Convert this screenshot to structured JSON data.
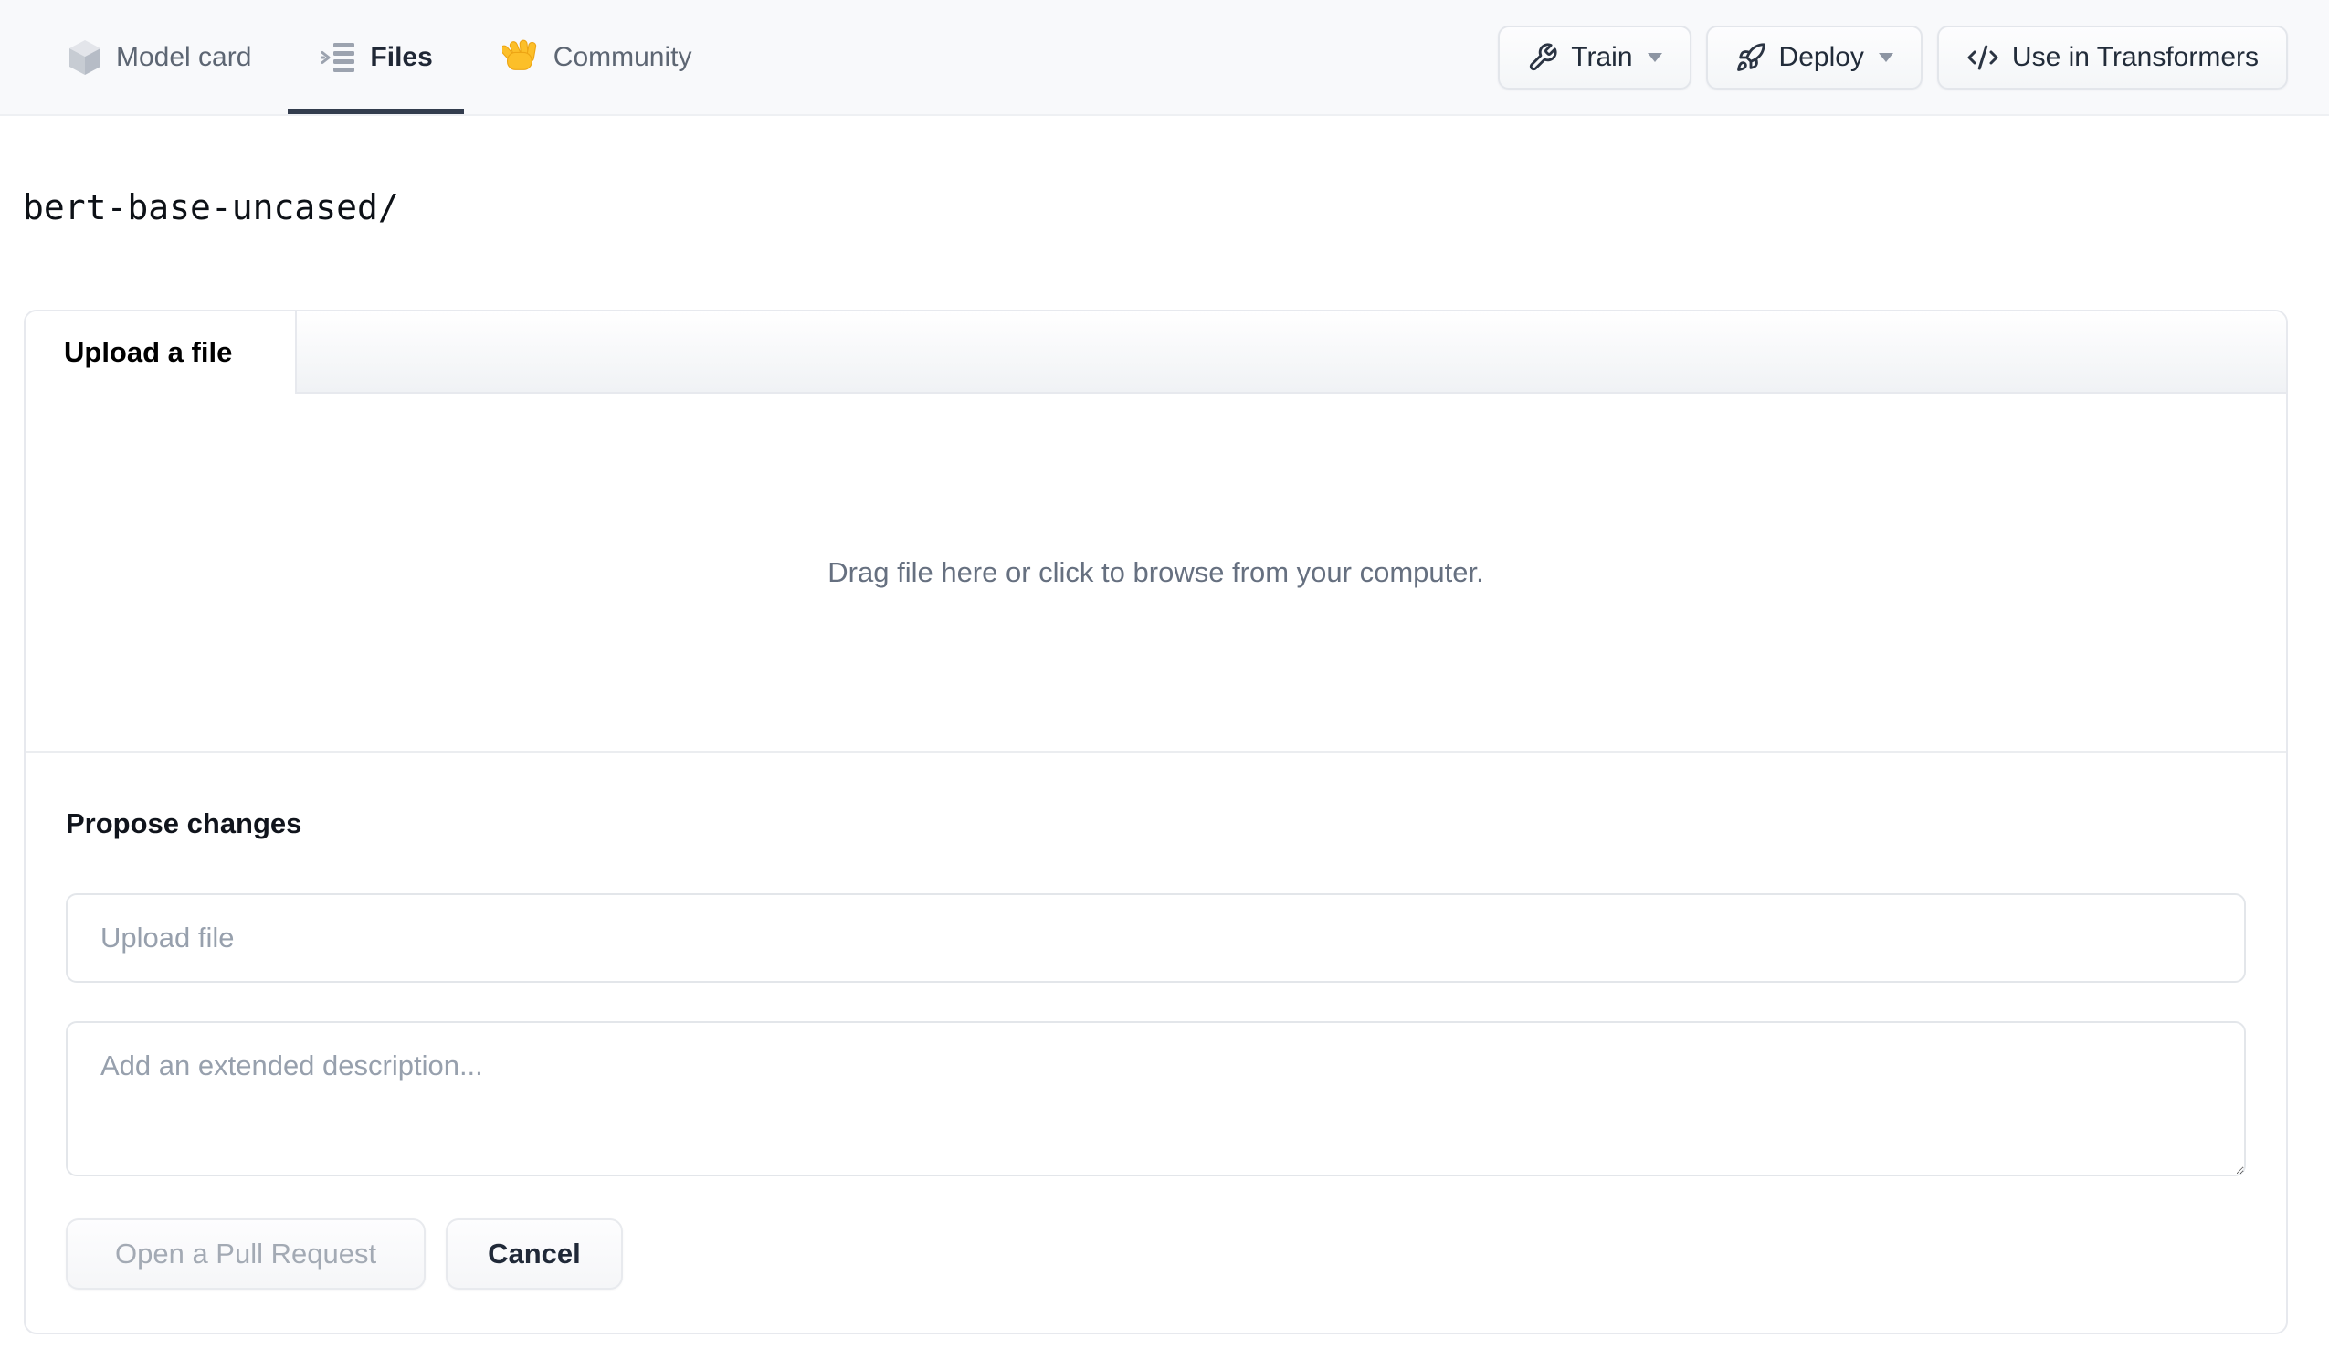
{
  "header": {
    "tabs": [
      {
        "label": "Model card",
        "icon": "cube-icon",
        "active": false
      },
      {
        "label": "Files",
        "icon": "files-list-icon",
        "active": true
      },
      {
        "label": "Community",
        "icon": "waving-hand-icon",
        "active": false
      }
    ],
    "actions": [
      {
        "label": "Train",
        "icon": "wrench-icon",
        "has_caret": true
      },
      {
        "label": "Deploy",
        "icon": "rocket-icon",
        "has_caret": true
      },
      {
        "label": "Use in Transformers",
        "icon": "code-icon",
        "has_caret": false
      }
    ]
  },
  "breadcrumb": {
    "path": "bert-base-uncased/"
  },
  "upload_card": {
    "tab_label": "Upload a file",
    "dropzone_text": "Drag file here or click to browse from your computer.",
    "propose": {
      "heading": "Propose changes",
      "filename_placeholder": "Upload file",
      "description_placeholder": "Add an extended description...",
      "description_value": "",
      "filename_value": "",
      "submit_label": "Open a Pull Request",
      "submit_enabled": false,
      "cancel_label": "Cancel"
    }
  },
  "colors": {
    "header_bg": "#f8f9fb",
    "active_tab_underline": "#333d4e",
    "nav_text": "#5d6673",
    "nav_active_text": "#1f2735",
    "card_border": "#e7e9ee",
    "placeholder_text": "#97a0ad",
    "dropzone_text": "#667080",
    "disabled_button_text": "#a3aab4",
    "hand_emoji_yellow": "#fcbf29"
  }
}
